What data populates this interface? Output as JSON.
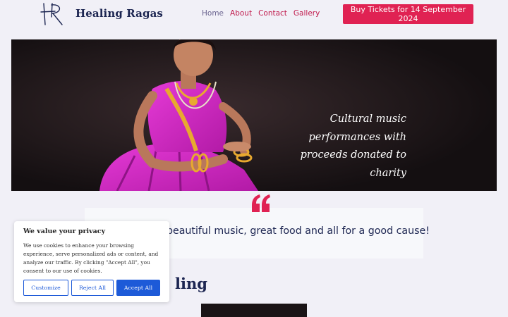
{
  "header": {
    "brand": "Healing Ragas",
    "logo_icon": "hr-monogram-logo",
    "nav": [
      {
        "label": "Home"
      },
      {
        "label": "About"
      },
      {
        "label": "Contact"
      },
      {
        "label": "Gallery"
      }
    ],
    "cta_label": "Buy Tickets for 14 September 2024"
  },
  "hero": {
    "caption": "Cultural music performances with proceeds donated to charity"
  },
  "quote": {
    "icon": "quote-mark-icon",
    "text": "beautiful music, great food and all for a good cause!"
  },
  "section": {
    "heading_visible": "ling"
  },
  "cookie_banner": {
    "title": "We value your privacy",
    "text": "We use cookies to enhance your browsing experience, serve personalized ads or content, and analyze our traffic. By clicking \"Accept All\", you consent to our use of cookies.",
    "customize_label": "Customize",
    "reject_label": "Reject All",
    "accept_label": "Accept All"
  },
  "colors": {
    "accent": "#e02253",
    "navy": "#1c2551",
    "background": "#f1f0f7",
    "cookie_button_blue": "#1d5ad8"
  }
}
